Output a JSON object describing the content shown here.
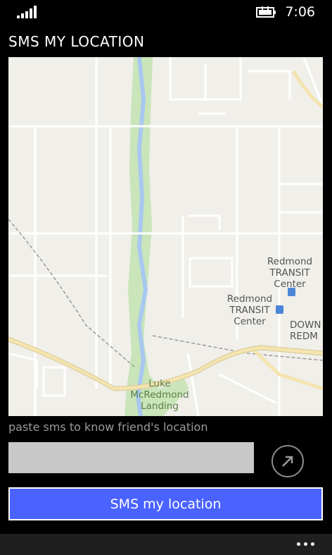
{
  "status": {
    "time": "7:06",
    "signal_icon": "signal-strength-icon",
    "battery_icon": "battery-charging-icon"
  },
  "app": {
    "title": "SMS MY LOCATION"
  },
  "map": {
    "labels": {
      "transit_1_line1": "Redmond",
      "transit_1_line2": "TRANSIT",
      "transit_1_line3": "Center",
      "transit_2_line1": "Redmond",
      "transit_2_line2": "TRANSIT",
      "transit_2_line3": "Center",
      "downtown_line1": "DOWN",
      "downtown_line2": "REDM",
      "park_line1": "Luke",
      "park_line2": "McRedmond",
      "park_line3": "Landing"
    },
    "colors": {
      "land": "#f0efea",
      "river": "#a8c8f0",
      "park": "#c9e5b9",
      "highway": "#f4e4b0"
    }
  },
  "share": {
    "hint": "paste sms to know friend's location",
    "input_value": "",
    "go_icon": "arrow-up-right-icon"
  },
  "actions": {
    "sms_button_label": "SMS my location",
    "more_icon": "more-dots-icon"
  }
}
